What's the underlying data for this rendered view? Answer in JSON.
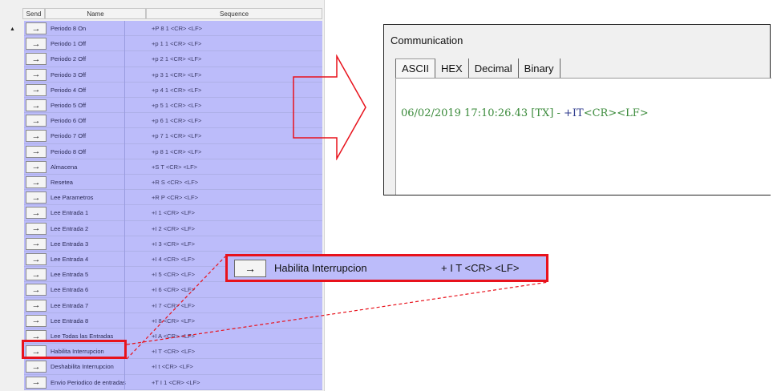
{
  "table": {
    "headers": {
      "send": "Send",
      "name": "Name",
      "sequence": "Sequence"
    },
    "scroll_marker": "▲",
    "rows": [
      {
        "button": "→",
        "name": "Periodo 8 On",
        "sequence": "+P 8 1 <CR> <LF>"
      },
      {
        "button": "→",
        "name": "Periodo 1 Off",
        "sequence": "+p 1 1 <CR> <LF>"
      },
      {
        "button": "→",
        "name": "Periodo 2 Off",
        "sequence": "+p 2 1 <CR> <LF>"
      },
      {
        "button": "→",
        "name": "Periodo 3 Off",
        "sequence": "+p 3 1 <CR> <LF>"
      },
      {
        "button": "→",
        "name": "Periodo 4 Off",
        "sequence": "+p 4 1 <CR> <LF>"
      },
      {
        "button": "→",
        "name": "Periodo 5 Off",
        "sequence": "+p 5 1 <CR> <LF>"
      },
      {
        "button": "→",
        "name": "Periodo 6 Off",
        "sequence": "+p 6 1 <CR> <LF>"
      },
      {
        "button": "→",
        "name": "Periodo 7 Off",
        "sequence": "+p 7 1 <CR> <LF>"
      },
      {
        "button": "→",
        "name": "Periodo 8 Off",
        "sequence": "+p 8 1 <CR> <LF>"
      },
      {
        "button": "→",
        "name": "Almacena",
        "sequence": "+S T <CR> <LF>"
      },
      {
        "button": "→",
        "name": "Resetea",
        "sequence": "+R S <CR> <LF>"
      },
      {
        "button": "→",
        "name": "Lee Parametros",
        "sequence": "+R P <CR> <LF>"
      },
      {
        "button": "→",
        "name": "Lee Entrada 1",
        "sequence": "+I 1 <CR> <LF>"
      },
      {
        "button": "→",
        "name": "Lee Entrada 2",
        "sequence": "+I 2 <CR> <LF>"
      },
      {
        "button": "→",
        "name": "Lee Entrada 3",
        "sequence": "+I 3 <CR> <LF>"
      },
      {
        "button": "→",
        "name": "Lee Entrada 4",
        "sequence": "+I 4 <CR> <LF>"
      },
      {
        "button": "→",
        "name": "Lee Entrada 5",
        "sequence": "+I 5 <CR> <LF>"
      },
      {
        "button": "→",
        "name": "Lee Entrada 6",
        "sequence": "+I 6 <CR> <LF>"
      },
      {
        "button": "→",
        "name": "Lee Entrada 7",
        "sequence": "+I 7 <CR> <LF>"
      },
      {
        "button": "→",
        "name": "Lee Entrada 8",
        "sequence": "+I 8 <CR> <LF>"
      },
      {
        "button": "→",
        "name": "Lee Todas las Entradas",
        "sequence": "+I A <CR> <LF>"
      },
      {
        "button": "→",
        "name": "Habilita Interrupcion",
        "sequence": "+I T <CR> <LF>"
      },
      {
        "button": "→",
        "name": "Deshabilita Interrupcion",
        "sequence": "+I t <CR> <LF>"
      },
      {
        "button": "→",
        "name": "Envio Periodico de entradas",
        "sequence": "+T I 1 <CR> <LF>"
      }
    ]
  },
  "communication": {
    "title": "Communication",
    "tabs": [
      "ASCII",
      "HEX",
      "Decimal",
      "Binary"
    ],
    "log": {
      "prefix": "06/02/2019 17:10:26.43 [TX] - ",
      "command": "+IT",
      "terminator": "<CR><LF>"
    }
  },
  "zoom": {
    "button": "→",
    "name": "Habilita Interrupcion",
    "sequence": "+ I T <CR> <LF>"
  },
  "colors": {
    "accent_red": "#e8121c",
    "row_background": "#bcbcfa",
    "log_green": "#3a8a3a",
    "log_blue": "#2c3a8c"
  }
}
